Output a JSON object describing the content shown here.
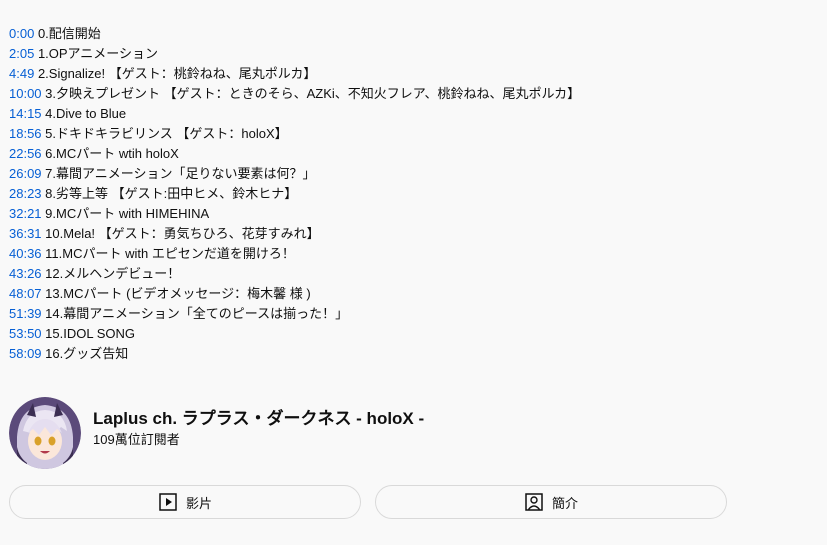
{
  "chapters": [
    {
      "time": "0:00",
      "title": "0.配信開始"
    },
    {
      "time": "2:05",
      "title": "1.OPアニメーション"
    },
    {
      "time": "4:49",
      "title": "2.Signalize! 【ゲスト：桃鈴ねね、尾丸ポルカ】"
    },
    {
      "time": "10:00",
      "title": "3.夕映えプレゼント 【ゲスト：ときのそら、AZKi、不知火フレア、桃鈴ねね、尾丸ポルカ】"
    },
    {
      "time": "14:15",
      "title": "4.Dive to Blue"
    },
    {
      "time": "18:56",
      "title": "5.ドキドキラビリンス 【ゲスト：holoX】"
    },
    {
      "time": "22:56",
      "title": "6.MCパート wtih holoX"
    },
    {
      "time": "26:09",
      "title": "7.幕間アニメーション「足りない要素は何？」"
    },
    {
      "time": "28:23",
      "title": "8.劣等上等 【ゲスト:田中ヒメ、鈴木ヒナ】"
    },
    {
      "time": "32:21",
      "title": "9.MCパート with HIMEHINA"
    },
    {
      "time": "36:31",
      "title": "10.Mela! 【ゲスト：勇気ちひろ、花芽すみれ】"
    },
    {
      "time": "40:36",
      "title": "11.MCパート with エピセンだ道を開けろ！"
    },
    {
      "time": "43:26",
      "title": "12.メルヘンデビュー！"
    },
    {
      "time": "48:07",
      "title": "13.MCパート (ビデオメッセージ：梅木馨 様 )"
    },
    {
      "time": "51:39",
      "title": "14.幕間アニメーション「全てのピースは揃った！」"
    },
    {
      "time": "53:50",
      "title": "15.IDOL SONG"
    },
    {
      "time": "58:09",
      "title": "16.グッズ告知"
    }
  ],
  "channel": {
    "name": "Laplus ch. ラプラス・ダークネス - holoX -",
    "subscribers": "109萬位訂閱者",
    "avatar_icon": "avatar-icon"
  },
  "buttons": {
    "videos_label": "影片",
    "videos_icon": "play-box-icon",
    "about_label": "簡介",
    "about_icon": "person-box-icon"
  },
  "colors": {
    "link": "#065fd4",
    "background": "#f9f9f9",
    "text": "#0f0f0f",
    "border": "#d9d9d9"
  }
}
